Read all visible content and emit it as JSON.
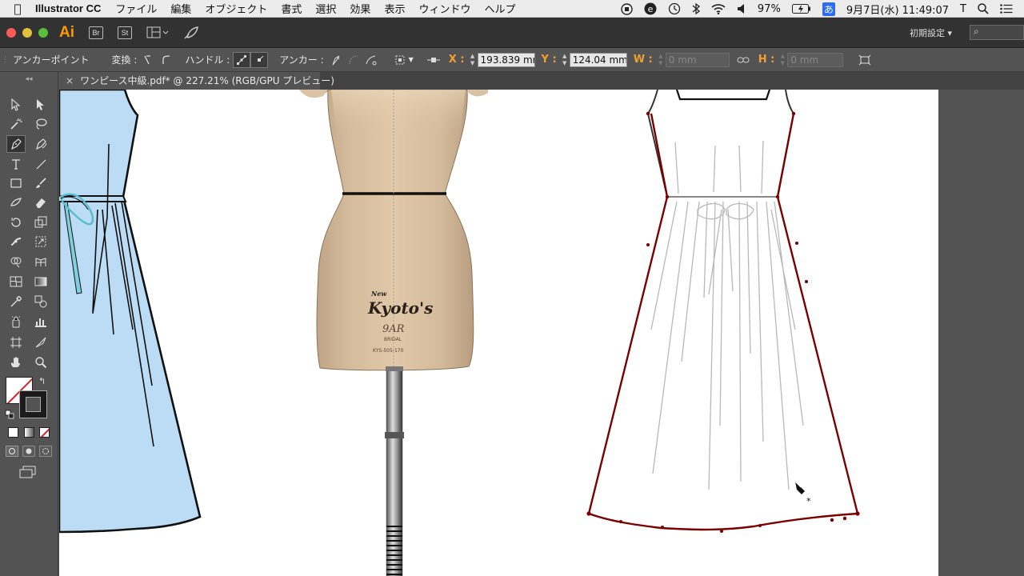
{
  "menubar": {
    "app": "Illustrator CC",
    "items": [
      "ファイル",
      "編集",
      "オブジェクト",
      "書式",
      "選択",
      "効果",
      "表示",
      "ウィンドウ",
      "ヘルプ"
    ],
    "battery": "97%",
    "ime": "あ",
    "datetime": "9月7日(水) 11:49:07",
    "user": "T"
  },
  "appbar": {
    "logo": "Ai",
    "bridge": "Br",
    "stock": "St",
    "workspace": "初期設定 ▾",
    "search_icon": "⌕"
  },
  "control": {
    "tool_name": "アンカーポイント",
    "transform_label": "変換 :",
    "handle_label": "ハンドル :",
    "anchor_label": "アンカー :",
    "x_label": "X :",
    "x_value": "193.839 mm",
    "y_label": "Y :",
    "y_value": "124.04 mm",
    "w_label": "W :",
    "w_value": "0 mm",
    "h_label": "H :",
    "h_value": "0 mm"
  },
  "document": {
    "tab_title": "ワンピース中級.pdf* @ 227.21% (RGB/GPU プレビュー)",
    "close": "×"
  },
  "mannequin": {
    "brand_small": "New",
    "brand": "Kyoto's",
    "size": "9AR",
    "sub": "BRIDAL",
    "code": "KYS-505-170"
  },
  "colors": {
    "accent": "#ff9a00",
    "axis_label": "#f0a030",
    "dress_fill": "#bcdcf5",
    "path_selected": "#7a0000",
    "belt": "#5bbccc"
  }
}
